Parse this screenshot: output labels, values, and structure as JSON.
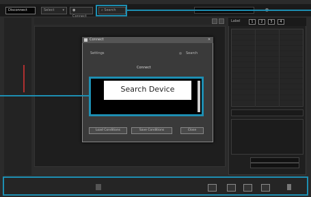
{
  "topbar": {
    "disconnect_label": "Disconnect",
    "dropdown_label": "Select",
    "connect_label": "Connect",
    "search_label": "Search"
  },
  "right_panel": {
    "label": "Label",
    "tabs": [
      "1",
      "2",
      "3",
      "4"
    ]
  },
  "dialog": {
    "title": "Connect",
    "row_label": "Settings",
    "row_right": "Search",
    "section_label": "Connect",
    "list_item": "Search Device",
    "buttons": [
      "Load Conditions",
      "Save Conditions",
      "Close"
    ]
  },
  "colors": {
    "highlight": "#1d8fb3",
    "app_background": "#2b2b2b"
  }
}
